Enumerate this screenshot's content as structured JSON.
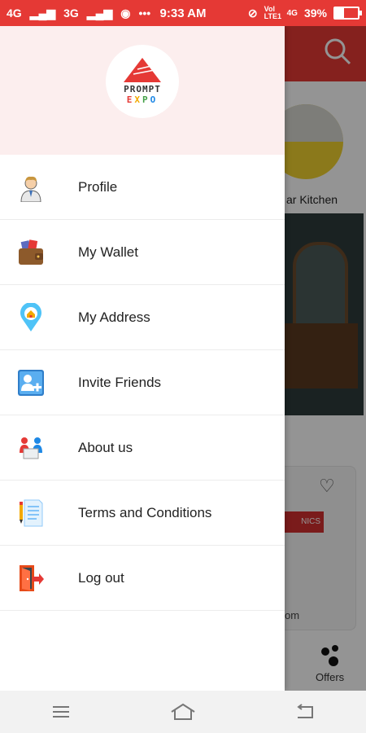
{
  "status_bar": {
    "network_1": "4G",
    "network_2": "3G",
    "time": "9:33 AM",
    "volte": "Vol LTE1",
    "network_3": "4G",
    "battery": "39%",
    "battery_level": 0.39,
    "color": "#e53935"
  },
  "drawer": {
    "logo": {
      "line1": "PROMPT",
      "line2": "EXPO"
    },
    "items": [
      {
        "label": "Profile",
        "icon": "profile-icon"
      },
      {
        "label": "My Wallet",
        "icon": "wallet-icon"
      },
      {
        "label": "My Address",
        "icon": "location-pin-icon"
      },
      {
        "label": "Invite Friends",
        "icon": "add-user-icon"
      },
      {
        "label": "About us",
        "icon": "team-icon"
      },
      {
        "label": "Terms and Conditions",
        "icon": "document-icon"
      },
      {
        "label": "Log out",
        "icon": "logout-icon"
      }
    ]
  },
  "background": {
    "category_label": "ar Kitchen",
    "brand_text": "NICS",
    "partial_text": "om",
    "offers_label": "Offers"
  },
  "nav_bar": {
    "buttons": [
      "menu-icon",
      "home-icon",
      "back-icon"
    ]
  }
}
